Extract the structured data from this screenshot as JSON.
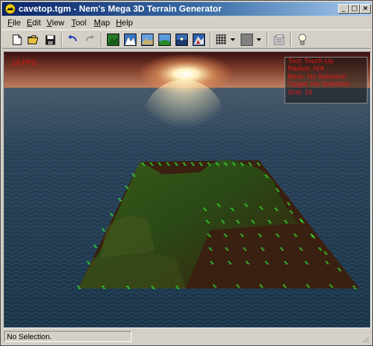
{
  "window": {
    "title": "cavetop.tgm - Nem's Mega 3D Terrain Generator"
  },
  "caption_buttons": {
    "minimize": "_",
    "maximize": "□",
    "close": "×"
  },
  "menu": {
    "items": [
      {
        "label": "File",
        "accel": "F",
        "rest": "ile"
      },
      {
        "label": "Edit",
        "accel": "E",
        "rest": "dit"
      },
      {
        "label": "View",
        "accel": "V",
        "rest": "iew"
      },
      {
        "label": "Tool",
        "accel": "T",
        "rest": "ool"
      },
      {
        "label": "Map",
        "accel": "M",
        "rest": "ap"
      },
      {
        "label": "Help",
        "accel": "H",
        "rest": "elp"
      }
    ]
  },
  "toolbar": {
    "buttons": [
      "new-icon",
      "open-icon",
      "save-icon",
      "undo-icon",
      "redo-icon",
      "terrain-view-1-icon",
      "terrain-view-2-icon",
      "terrain-view-3-icon",
      "terrain-view-4-icon",
      "terrain-view-5-icon",
      "terrain-view-6-icon",
      "grid-icon",
      "color-icon",
      "properties-icon",
      "lightbulb-icon"
    ]
  },
  "viewport": {
    "fps": "10 FPS",
    "info": [
      "Tool: Touch Up",
      "Radius: N/A",
      "Base: No Selection",
      "Target: No Selection",
      "Grid: 16"
    ]
  },
  "statusbar": {
    "text": "No Selection."
  },
  "colors": {
    "title_start": "#0a246a",
    "title_end": "#a6caf0",
    "overlay_text": "#e01818",
    "grid_marker": "#33ff33"
  }
}
